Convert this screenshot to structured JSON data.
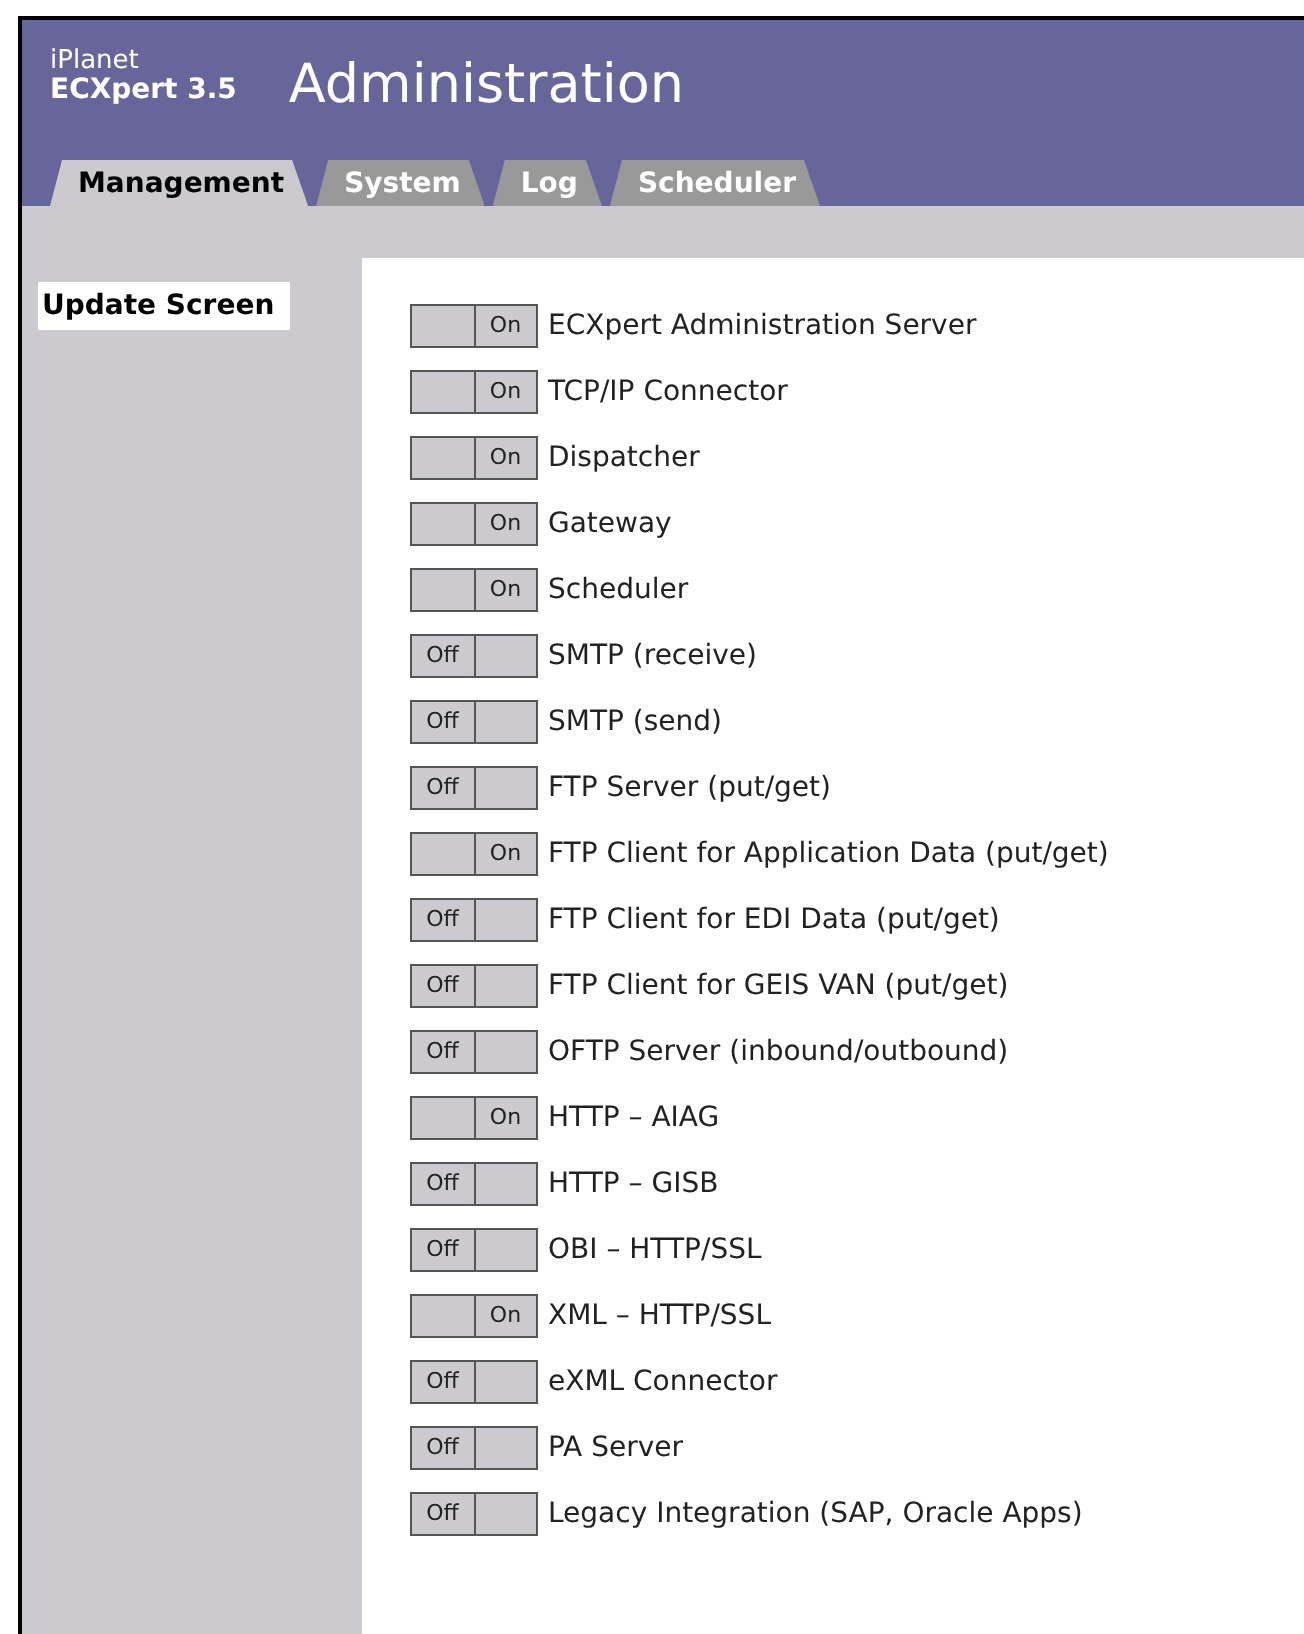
{
  "brand": {
    "line_1": "iPlanet",
    "line_2": "ECXpert 3.5"
  },
  "title": "Administration",
  "tabs": [
    {
      "label": "Management",
      "selected": true
    },
    {
      "label": "System",
      "selected": false
    },
    {
      "label": "Log",
      "selected": false
    },
    {
      "label": "Scheduler",
      "selected": false
    }
  ],
  "sidebar": {
    "items": [
      {
        "label": "Update Screen",
        "selected": true
      }
    ]
  },
  "services": [
    {
      "label": "ECXpert Administration Server",
      "on": true,
      "switch_text": "On"
    },
    {
      "label": "TCP/IP Connector",
      "on": true,
      "switch_text": "On"
    },
    {
      "label": "Dispatcher",
      "on": true,
      "switch_text": "On"
    },
    {
      "label": "Gateway",
      "on": true,
      "switch_text": "On"
    },
    {
      "label": "Scheduler",
      "on": true,
      "switch_text": "On"
    },
    {
      "label": "SMTP (receive)",
      "on": false,
      "switch_text": "Off"
    },
    {
      "label": "SMTP (send)",
      "on": false,
      "switch_text": "Off"
    },
    {
      "label": "FTP Server (put/get)",
      "on": false,
      "switch_text": "Off"
    },
    {
      "label": "FTP Client for Application Data (put/get)",
      "on": true,
      "switch_text": "On"
    },
    {
      "label": "FTP Client for EDI Data (put/get)",
      "on": false,
      "switch_text": "Off"
    },
    {
      "label": "FTP Client for GEIS VAN (put/get)",
      "on": false,
      "switch_text": "Off"
    },
    {
      "label": "OFTP Server (inbound/outbound)",
      "on": false,
      "switch_text": "Off"
    },
    {
      "label": "HTTP – AIAG",
      "on": true,
      "switch_text": "On"
    },
    {
      "label": "HTTP – GISB",
      "on": false,
      "switch_text": "Off"
    },
    {
      "label": "OBI – HTTP/SSL",
      "on": false,
      "switch_text": "Off"
    },
    {
      "label": "XML – HTTP/SSL",
      "on": true,
      "switch_text": "On"
    },
    {
      "label": "eXML Connector",
      "on": false,
      "switch_text": "Off"
    },
    {
      "label": "PA Server",
      "on": false,
      "switch_text": "Off"
    },
    {
      "label": "Legacy Integration (SAP, Oracle Apps)",
      "on": false,
      "switch_text": "Off"
    }
  ]
}
